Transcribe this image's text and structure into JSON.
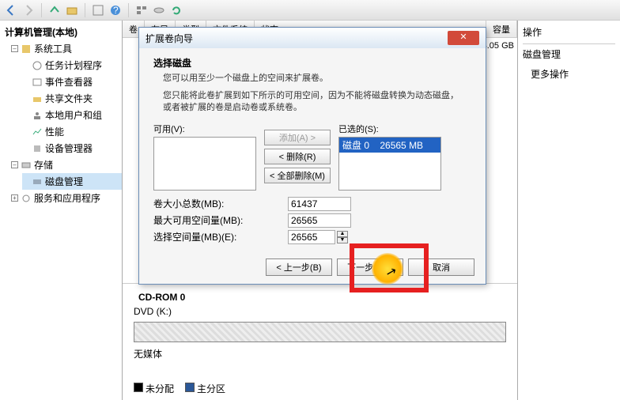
{
  "toolbar_icons": [
    "back-icon",
    "forward-icon",
    "up-icon",
    "refresh-icon",
    "help-icon",
    "prop-icon",
    "sep",
    "folder-icon",
    "view-icon",
    "sep2"
  ],
  "tree": {
    "title": "计算机管理(本地)",
    "system_tools": "系统工具",
    "task_scheduler": "任务计划程序",
    "event_viewer": "事件查看器",
    "shared_folders": "共享文件夹",
    "local_users": "本地用户和组",
    "performance": "性能",
    "device_manager": "设备管理器",
    "storage": "存储",
    "disk_mgmt": "磁盘管理",
    "services": "服务和应用程序"
  },
  "list_header": {
    "vol": "卷",
    "layout": "布局",
    "type": "类型",
    "fs": "文件系统",
    "status": "状态",
    "cap": "容量"
  },
  "cap_value": "34.05 GB",
  "right": {
    "title": "操作",
    "section": "磁盘管理",
    "more": "更多操作"
  },
  "disk": {
    "name": "CD-ROM 0",
    "sub": "DVD (K:)",
    "status": "无媒体"
  },
  "legend": {
    "unalloc": "未分配",
    "primary": "主分区"
  },
  "dialog": {
    "title": "扩展卷向导",
    "section": "选择磁盘",
    "subtitle": "您可以用至少一个磁盘上的空间来扩展卷。",
    "note": "您只能将此卷扩展到如下所示的可用空间，因为不能将磁盘转换为动态磁盘，或者被扩展的卷是启动卷或系统卷。",
    "avail": "可用(V):",
    "selected": "已选的(S):",
    "disk_entry": "磁盘 0",
    "disk_size": "26565 MB",
    "btn_add": "添加(A) >",
    "btn_remove": "< 删除(R)",
    "btn_remove_all": "< 全部删除(M)",
    "total_label": "卷大小总数(MB):",
    "total_val": "61437",
    "max_label": "最大可用空间量(MB):",
    "max_val": "26565",
    "sel_label": "选择空间量(MB)(E):",
    "sel_val": "26565",
    "back": "< 上一步(B)",
    "next": "下一步(N) >",
    "cancel": "取消"
  }
}
